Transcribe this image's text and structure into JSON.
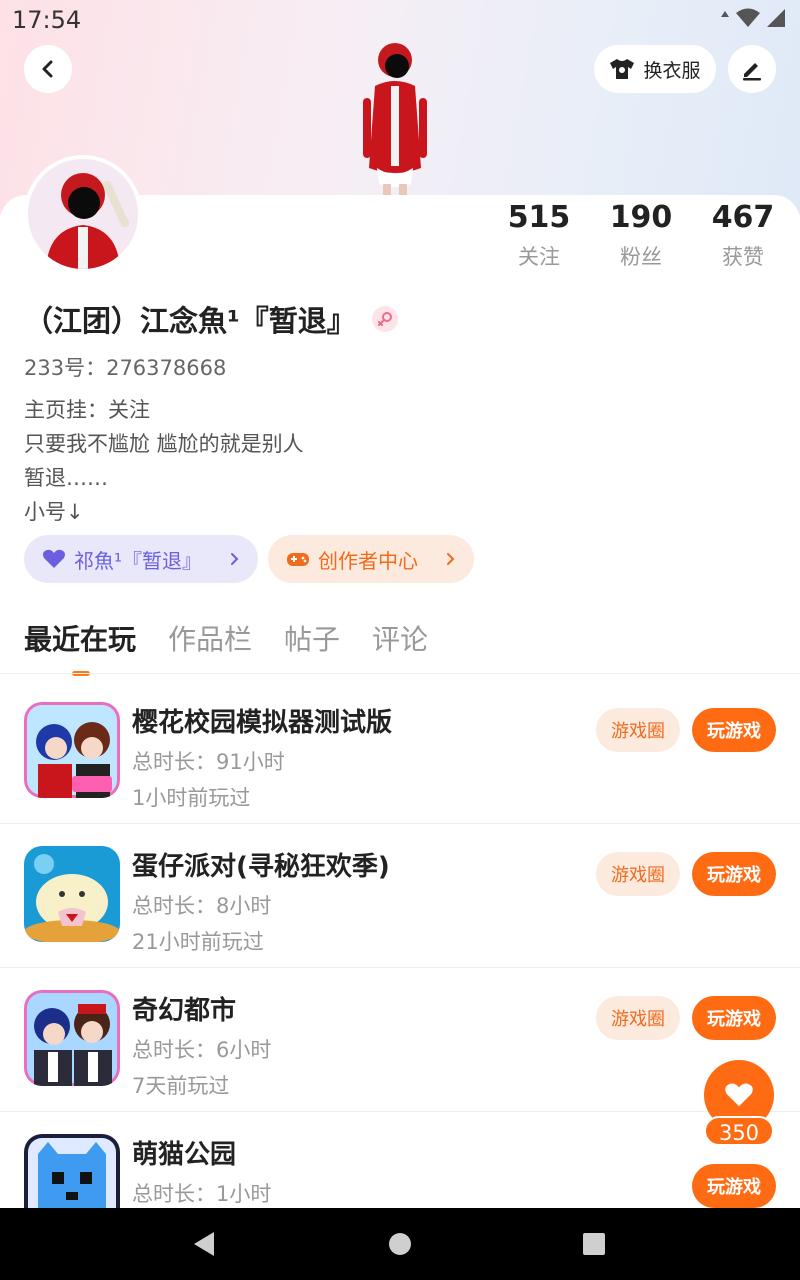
{
  "status": {
    "time": "17:54"
  },
  "header": {
    "outfit_label": "换衣服"
  },
  "stats": [
    {
      "value": "515",
      "label": "关注"
    },
    {
      "value": "190",
      "label": "粉丝"
    },
    {
      "value": "467",
      "label": "获赞"
    }
  ],
  "profile": {
    "name": "（江团）江念魚¹『暂退』",
    "uid": "233号：276378668",
    "bio": [
      "主页挂：关注",
      "只要我不尴尬 尴尬的就是别人",
      "暂退……",
      "小号↓"
    ]
  },
  "links": {
    "friend": "祁魚¹『暂退』",
    "creator": "创作者中心"
  },
  "tabs": [
    "最近在玩",
    "作品栏",
    "帖子",
    "评论"
  ],
  "games": [
    {
      "title": "樱花校园模拟器测试版",
      "duration": "总时长：91小时",
      "last_played": "1小时前玩过",
      "circle": "游戏圈",
      "play": "玩游戏"
    },
    {
      "title": "蛋仔派对(寻秘狂欢季)",
      "duration": "总时长：8小时",
      "last_played": "21小时前玩过",
      "circle": "游戏圈",
      "play": "玩游戏"
    },
    {
      "title": "奇幻都市",
      "duration": "总时长：6小时",
      "last_played": "7天前玩过",
      "circle": "游戏圈",
      "play": "玩游戏"
    },
    {
      "title": "萌猫公园",
      "duration": "总时长：1小时",
      "last_played": "",
      "circle": "",
      "play": "玩游戏"
    }
  ],
  "fab": {
    "count": "350"
  },
  "colors": {
    "accent": "#ff6b12",
    "accent_soft": "#fdeadf",
    "friend_purple": "#6b5fe0"
  }
}
